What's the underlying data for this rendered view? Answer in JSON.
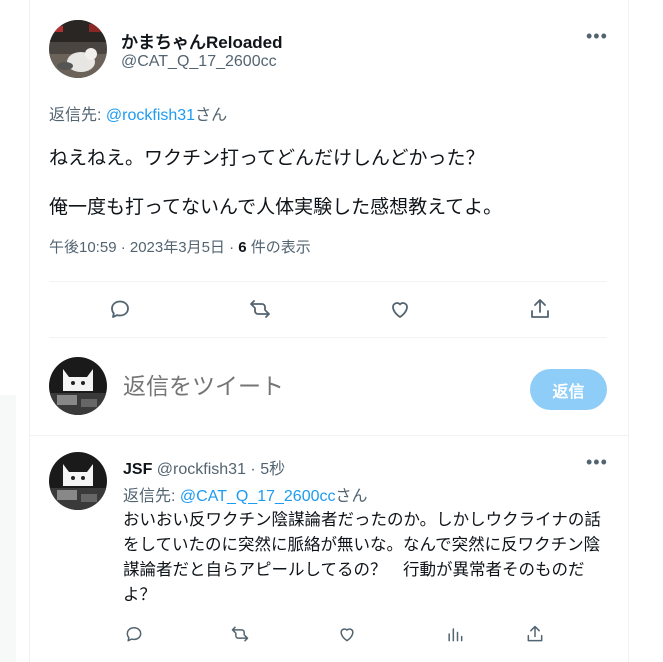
{
  "main_tweet": {
    "display_name": "かまちゃんReloaded",
    "handle": "@CAT_Q_17_2600cc",
    "reply_prefix": "返信先: ",
    "reply_target": "@rockfish31",
    "reply_suffix": "さん",
    "text_line_1": "ねえねえ。ワクチン打ってどんだけしんどかった？",
    "text_line_2": "俺一度も打ってないんで人体実験した感想教えてよ。",
    "timestamp": "午後10:59 · 2023年3月5日 · ",
    "view_count": "6",
    "view_label": " 件の表示",
    "more_icon": "more-icon"
  },
  "compose": {
    "placeholder": "返信をツイート",
    "reply_button": "返信"
  },
  "reply_tweet": {
    "display_name": "JSF",
    "handle": "@rockfish31",
    "separator": " · ",
    "time": "5秒",
    "reply_prefix": "返信先: ",
    "reply_target": "@CAT_Q_17_2600cc",
    "reply_suffix": "さん",
    "text": "おいおい反ワクチン陰謀論者だったのか。しかしウクライナの話をしていたのに突然に脈絡が無いな。なんで突然に反ワクチン陰謀論者だと自らアピールしてるの？　行動が異常者そのものだよ？"
  },
  "colors": {
    "accent": "#1d9bf0",
    "muted_text": "#536471",
    "text": "#0f1419",
    "reply_button_bg": "#8ecdf8",
    "divider": "#eff3f4"
  }
}
